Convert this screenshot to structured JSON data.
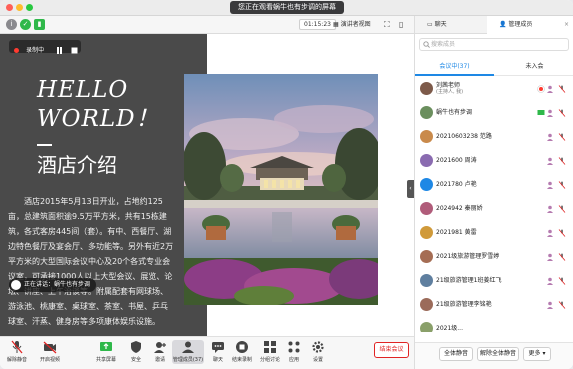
{
  "titlebar": {
    "sharing_text": "您正在观看蜗牛也有步调的屏幕"
  },
  "toolbar": {
    "timer": "01:15:23",
    "view_label": "演讲者视图"
  },
  "recording": {
    "label": "录制中"
  },
  "slide": {
    "hello_line1": "HELLO",
    "hello_line2": "WORLD！",
    "title": "酒店介绍",
    "body": "酒店2015年5月13日开业，占地约125亩，总建筑面积逾9.5万平方米，共有15栋建筑，各式客房445间（套）。有中、西餐厅、湖边特色餐厅及宴会厅、多功能等。另外有近2万平方米的大型国际会议中心及20个各式专业会议室，可承接1000人以上大型会议、展览、论坛、讲座、上午治谈等。附属配套有网球场、游泳池、桃康室、桌球室、茶室、书屋、乒乓球室、汗蒸、健身房等多项康体娱乐设施。",
    "speaker": "正在讲话：蜗牛也有步调"
  },
  "bottombar": {
    "items": [
      {
        "label": "解除静音",
        "icon": "mic-muted-icon"
      },
      {
        "label": "开启视频",
        "icon": "video-off-icon"
      },
      {
        "label": "共享屏幕",
        "icon": "share-screen-icon"
      },
      {
        "label": "安全",
        "icon": "shield-icon"
      },
      {
        "label": "邀请",
        "icon": "invite-icon"
      },
      {
        "label": "管理成员(37)",
        "icon": "members-icon"
      },
      {
        "label": "聊天",
        "icon": "chat-icon"
      },
      {
        "label": "结束录制",
        "icon": "stop-record-icon"
      },
      {
        "label": "分组讨论",
        "icon": "breakout-icon"
      },
      {
        "label": "应用",
        "icon": "apps-icon"
      },
      {
        "label": "设置",
        "icon": "settings-icon"
      }
    ],
    "end_label": "结束会议"
  },
  "panel": {
    "tab_chat": "聊天",
    "tab_members": "管理成员",
    "search_placeholder": "搜索成员",
    "subtab_in": "会议中(37)",
    "subtab_waiting": "未入会",
    "members": [
      {
        "name": "刘茜老师",
        "role": "(主持人, 我)",
        "color": "#7d5a4a"
      },
      {
        "name": "蜗牛也有步调",
        "role": "",
        "color": "#6b8f5e"
      },
      {
        "name": "20210603238 范路",
        "role": "",
        "color": "#c98a4b"
      },
      {
        "name": "2021600 周涛",
        "role": "",
        "color": "#8a6bb0"
      },
      {
        "name": "2021780 卢艳",
        "role": "",
        "color": "#1e88e5"
      },
      {
        "name": "2024942 秦丽娇",
        "role": "",
        "color": "#b05c7a"
      },
      {
        "name": "2021981 黄雷",
        "role": "",
        "color": "#d09a3a"
      },
      {
        "name": "2021级旅游管理罗雪婷",
        "role": "",
        "color": "#a56d54"
      },
      {
        "name": "21级旅游管理1班姜红飞",
        "role": "",
        "color": "#5f7f9f"
      },
      {
        "name": "21级旅游管理李铭艳",
        "role": "",
        "color": "#9b6b5a"
      },
      {
        "name": "2021级...",
        "role": "",
        "color": "#8aa06a"
      }
    ],
    "mute_all": "全体静音",
    "unmute_all": "解除全体静音",
    "more": "更多"
  },
  "colors": {
    "accent": "#1e88e5",
    "danger": "#e02424",
    "slide_bg": "#4a4a4a"
  }
}
